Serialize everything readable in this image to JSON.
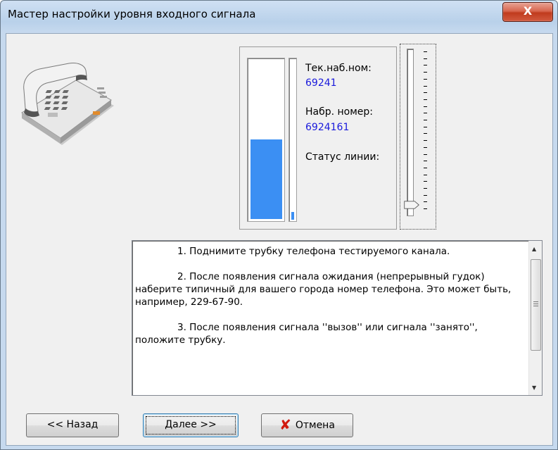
{
  "window": {
    "title": "Мастер настройки уровня входного сигнала",
    "close_label": "X"
  },
  "meter": {
    "level_fraction": 0.5,
    "aux_fraction": 0.05,
    "current_number_label": "Тек.наб.ном:",
    "current_number_value": "69241",
    "dialed_number_label": "Набр. номер:",
    "dialed_number_value": "6924161",
    "line_status_label": "Статус линии:",
    "line_status_value": ""
  },
  "slider": {
    "level_fraction": 0.02
  },
  "instructions": {
    "step1": "1. Поднимите трубку телефона  тестируемого канала.",
    "step2": "2. После появления сигнала ожидания (непрерывный гудок) наберите типичный для вашего города номер телефона. Это может быть, например, 229-67-90.",
    "step3": "3. После появления сигнала ''вызов'' или сигнала  ''занято'', положите трубку."
  },
  "buttons": {
    "back": "<< Назад",
    "next": "Далее >>",
    "cancel": "Отмена"
  },
  "icons": {
    "phone": "telephone-icon",
    "cancel": "red-x-icon",
    "cancel_color": "#d11a0f"
  }
}
